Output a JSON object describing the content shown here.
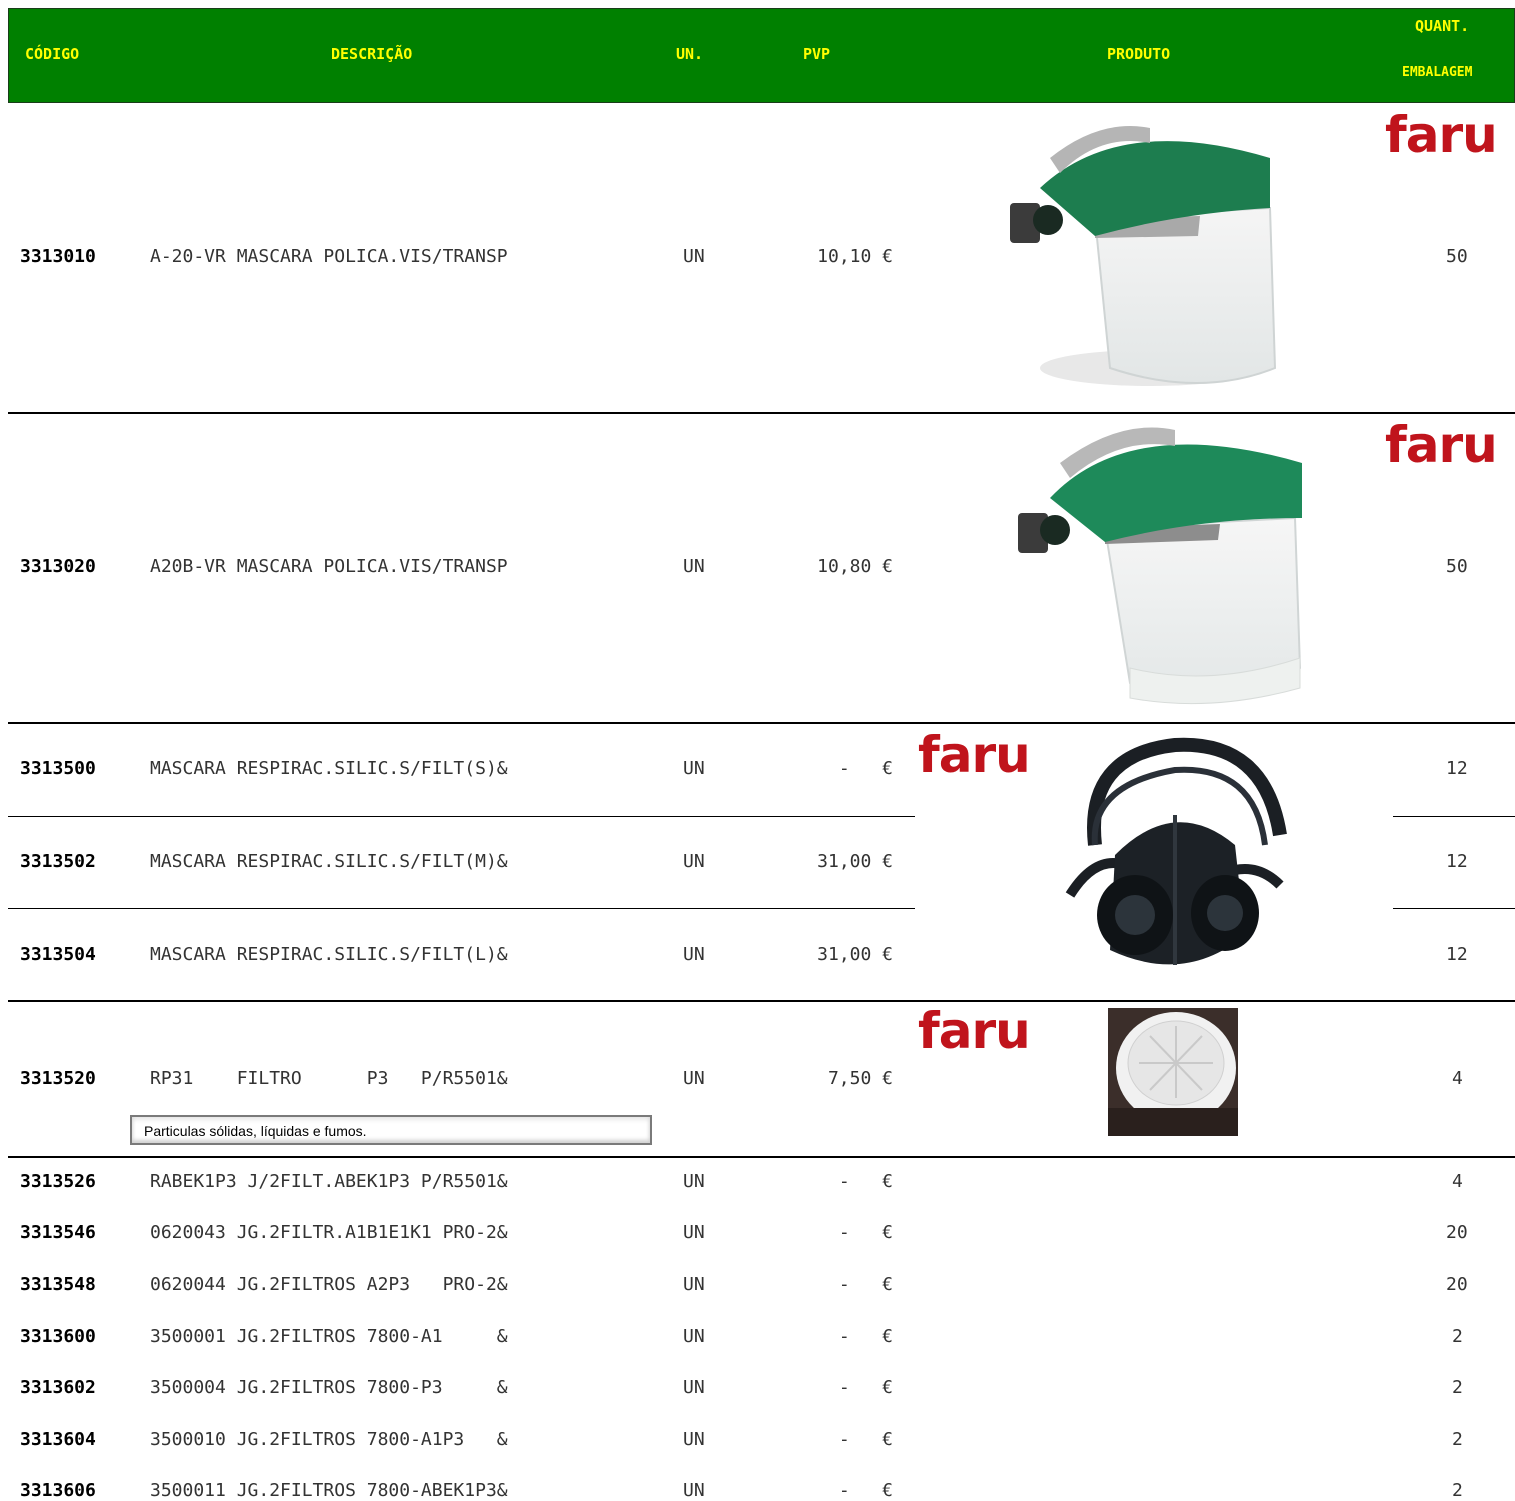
{
  "header": {
    "codigo": "CÓDIGO",
    "descricao": "DESCRIÇÃO",
    "un": "UN.",
    "pvp": "PVP",
    "produto": "PRODUTO",
    "quant_1": "QUANT.",
    "quant_2": "EMBALAGEM"
  },
  "brand": "faru",
  "note": "Particulas sólidas, líquidas e fumos.",
  "rows": [
    {
      "code": "3313010",
      "desc": "A-20-VR MASCARA POLICA.VIS/TRANSP",
      "un": "UN",
      "pvp": "10,10 €",
      "qty": "50"
    },
    {
      "code": "3313020",
      "desc": "A20B-VR MASCARA POLICA.VIS/TRANSP",
      "un": "UN",
      "pvp": "10,80 €",
      "qty": "50"
    },
    {
      "code": "3313500",
      "desc": "MASCARA RESPIRAC.SILIC.S/FILT(S)&",
      "un": "UN",
      "pvp": "-   €",
      "qty": "12"
    },
    {
      "code": "3313502",
      "desc": "MASCARA RESPIRAC.SILIC.S/FILT(M)&",
      "un": "UN",
      "pvp": "31,00 €",
      "qty": "12"
    },
    {
      "code": "3313504",
      "desc": "MASCARA RESPIRAC.SILIC.S/FILT(L)&",
      "un": "UN",
      "pvp": "31,00 €",
      "qty": "12"
    },
    {
      "code": "3313520",
      "desc": "RP31    FILTRO      P3   P/R5501&",
      "un": "UN",
      "pvp": "7,50 €",
      "qty": "4"
    },
    {
      "code": "3313526",
      "desc": "RABEK1P3 J/2FILT.ABEK1P3 P/R5501&",
      "un": "UN",
      "pvp": "-   €",
      "qty": "4"
    },
    {
      "code": "3313546",
      "desc": "0620043 JG.2FILTR.A1B1E1K1 PRO-2&",
      "un": "UN",
      "pvp": "-   €",
      "qty": "20"
    },
    {
      "code": "3313548",
      "desc": "0620044 JG.2FILTROS A2P3   PRO-2&",
      "un": "UN",
      "pvp": "-   €",
      "qty": "20"
    },
    {
      "code": "3313600",
      "desc": "3500001 JG.2FILTROS 7800-A1     &",
      "un": "UN",
      "pvp": "-   €",
      "qty": "2"
    },
    {
      "code": "3313602",
      "desc": "3500004 JG.2FILTROS 7800-P3     &",
      "un": "UN",
      "pvp": "-   €",
      "qty": "2"
    },
    {
      "code": "3313604",
      "desc": "3500010 JG.2FILTROS 7800-A1P3   &",
      "un": "UN",
      "pvp": "-   €",
      "qty": "2"
    },
    {
      "code": "3313606",
      "desc": "3500011 JG.2FILTROS 7800-ABEK1P3&",
      "un": "UN",
      "pvp": "-   €",
      "qty": "2"
    }
  ]
}
